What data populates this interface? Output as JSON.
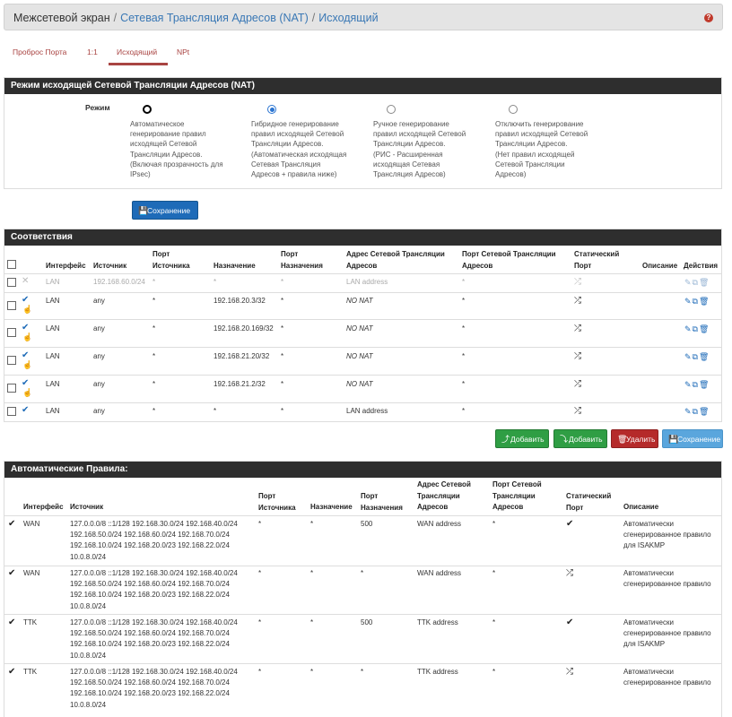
{
  "breadcrumb": {
    "root": "Межсетевой экран",
    "sep1": "/",
    "nat": "Сетевая Трансляция Адресов (NAT)",
    "sep2": "/",
    "current": "Исходящий",
    "help_icon": "?"
  },
  "tabs": [
    {
      "label": "Проброс Порта"
    },
    {
      "label": "1:1"
    },
    {
      "label": "Исходящий"
    },
    {
      "label": "NPt"
    }
  ],
  "mode_panel": {
    "title": "Режим исходящей Сетевой Трансляции Адресов (NAT)",
    "mode_label": "Режим",
    "options": [
      {
        "lines": [
          "Автоматическое",
          "генерирование правил",
          "исходящей Сетевой",
          "Трансляции Адресов.",
          "(Включая прозрачность для",
          "IPsec)"
        ]
      },
      {
        "lines": [
          "Гибридное генерирование",
          "правил исходящей Сетевой",
          "Трансляции Адресов.",
          "(Автоматическая исходящая",
          "Сетевая Трансляция",
          "Адресов + правила ниже)"
        ]
      },
      {
        "lines": [
          "Ручное генерирование",
          "правил исходящей Сетевой",
          "Трансляции Адресов.",
          "(РИС - Расширенная",
          "исходящая Сетевая",
          "Трансляция Адресов)"
        ]
      },
      {
        "lines": [
          "Отключить генерирование",
          "правил исходящей Сетевой",
          "Трансляции Адресов.",
          "(Нет правил исходящей",
          "Сетевой Трансляции",
          "Адресов)"
        ]
      }
    ],
    "save_label": "Сохранение"
  },
  "mappings": {
    "title": "Соответствия",
    "headers": {
      "interface": "Интерфейс",
      "source": "Источник",
      "src_port": [
        "Порт",
        "Источника"
      ],
      "dest": "Назначение",
      "dest_port": [
        "Порт",
        "Назначения"
      ],
      "nat_addr": [
        "Адрес Сетевой Трансляции",
        "Адресов"
      ],
      "nat_port": [
        "Порт Сетевой Трансляции",
        "Адресов"
      ],
      "static_port": [
        "Статический",
        "Порт"
      ],
      "description": "Описание",
      "actions": "Действия"
    },
    "rows": [
      {
        "enabled": false,
        "iface": "LAN",
        "source": "192.168.60.0/24",
        "src_port": "*",
        "dest": "*",
        "dest_port": "*",
        "nat_addr": "LAN address",
        "nat_port": "*",
        "nat_italic": false
      },
      {
        "enabled": true,
        "iface": "LAN",
        "source": "any",
        "src_port": "*",
        "dest": "192.168.20.3/32",
        "dest_port": "*",
        "nat_addr": "NO NAT",
        "nat_port": "*",
        "nat_italic": true
      },
      {
        "enabled": true,
        "iface": "LAN",
        "source": "any",
        "src_port": "*",
        "dest": "192.168.20.169/32",
        "dest_port": "*",
        "nat_addr": "NO NAT",
        "nat_port": "*",
        "nat_italic": true
      },
      {
        "enabled": true,
        "iface": "LAN",
        "source": "any",
        "src_port": "*",
        "dest": "192.168.21.20/32",
        "dest_port": "*",
        "nat_addr": "NO NAT",
        "nat_port": "*",
        "nat_italic": true
      },
      {
        "enabled": true,
        "iface": "LAN",
        "source": "any",
        "src_port": "*",
        "dest": "192.168.21.2/32",
        "dest_port": "*",
        "nat_addr": "NO NAT",
        "nat_port": "*",
        "nat_italic": true
      },
      {
        "enabled": true,
        "iface": "LAN",
        "source": "any",
        "src_port": "*",
        "dest": "*",
        "dest_port": "*",
        "nat_addr": "LAN address",
        "nat_port": "*",
        "nat_italic": false
      }
    ],
    "buttons": {
      "add_top": "Добавить",
      "add_bottom": "Добавить",
      "delete": "Удалить",
      "save": "Сохранение"
    }
  },
  "auto_rules": {
    "title": "Автоматические Правила:",
    "headers": {
      "interface": "Интерфейс",
      "source": "Источник",
      "src_port": [
        "Порт",
        "Источника"
      ],
      "dest": "Назначение",
      "dest_port": [
        "Порт",
        "Назначения"
      ],
      "nat_addr": [
        "Адрес Сетевой",
        "Трансляции",
        "Адресов"
      ],
      "nat_port": [
        "Порт Сетевой",
        "Трансляции",
        "Адресов"
      ],
      "static_port": [
        "Статический",
        "Порт"
      ],
      "description": "Описание"
    },
    "rows": [
      {
        "iface": "WAN",
        "source": [
          "127.0.0.0/8 ::1/128 192.168.30.0/24 192.168.40.0/24",
          "192.168.50.0/24 192.168.60.0/24 192.168.70.0/24",
          "192.168.10.0/24 192.168.20.0/23 192.168.22.0/24",
          "10.0.8.0/24"
        ],
        "src_port": "*",
        "dest": "*",
        "dest_port": "500",
        "nat_addr": "WAN address",
        "nat_port": "*",
        "static": true,
        "desc": [
          "Автоматически",
          "сгенерированное правило",
          "для ISAKMP"
        ]
      },
      {
        "iface": "WAN",
        "source": [
          "127.0.0.0/8 ::1/128 192.168.30.0/24 192.168.40.0/24",
          "192.168.50.0/24 192.168.60.0/24 192.168.70.0/24",
          "192.168.10.0/24 192.168.20.0/23 192.168.22.0/24",
          "10.0.8.0/24"
        ],
        "src_port": "*",
        "dest": "*",
        "dest_port": "*",
        "nat_addr": "WAN address",
        "nat_port": "*",
        "static": false,
        "desc": [
          "Автоматически",
          "сгенерированное правило"
        ]
      },
      {
        "iface": "TTK",
        "source": [
          "127.0.0.0/8 ::1/128 192.168.30.0/24 192.168.40.0/24",
          "192.168.50.0/24 192.168.60.0/24 192.168.70.0/24",
          "192.168.10.0/24 192.168.20.0/23 192.168.22.0/24",
          "10.0.8.0/24"
        ],
        "src_port": "*",
        "dest": "*",
        "dest_port": "500",
        "nat_addr": "TTK address",
        "nat_port": "*",
        "static": true,
        "desc": [
          "Автоматически",
          "сгенерированное правило",
          "для ISAKMP"
        ]
      },
      {
        "iface": "TTK",
        "source": [
          "127.0.0.0/8 ::1/128 192.168.30.0/24 192.168.40.0/24",
          "192.168.50.0/24 192.168.60.0/24 192.168.70.0/24",
          "192.168.10.0/24 192.168.20.0/23 192.168.22.0/24",
          "10.0.8.0/24"
        ],
        "src_port": "*",
        "dest": "*",
        "dest_port": "*",
        "nat_addr": "TTK address",
        "nat_port": "*",
        "static": false,
        "desc": [
          "Автоматически",
          "сгенерированное правило"
        ]
      }
    ]
  },
  "icons": {
    "check": "✔",
    "x": "✕",
    "hand": "☝",
    "shuffle": "⤮",
    "edit": "✎",
    "copy": "⧉",
    "trash": "🗑",
    "save": "💾",
    "add_up": "⤴",
    "add_down": "⤵"
  }
}
